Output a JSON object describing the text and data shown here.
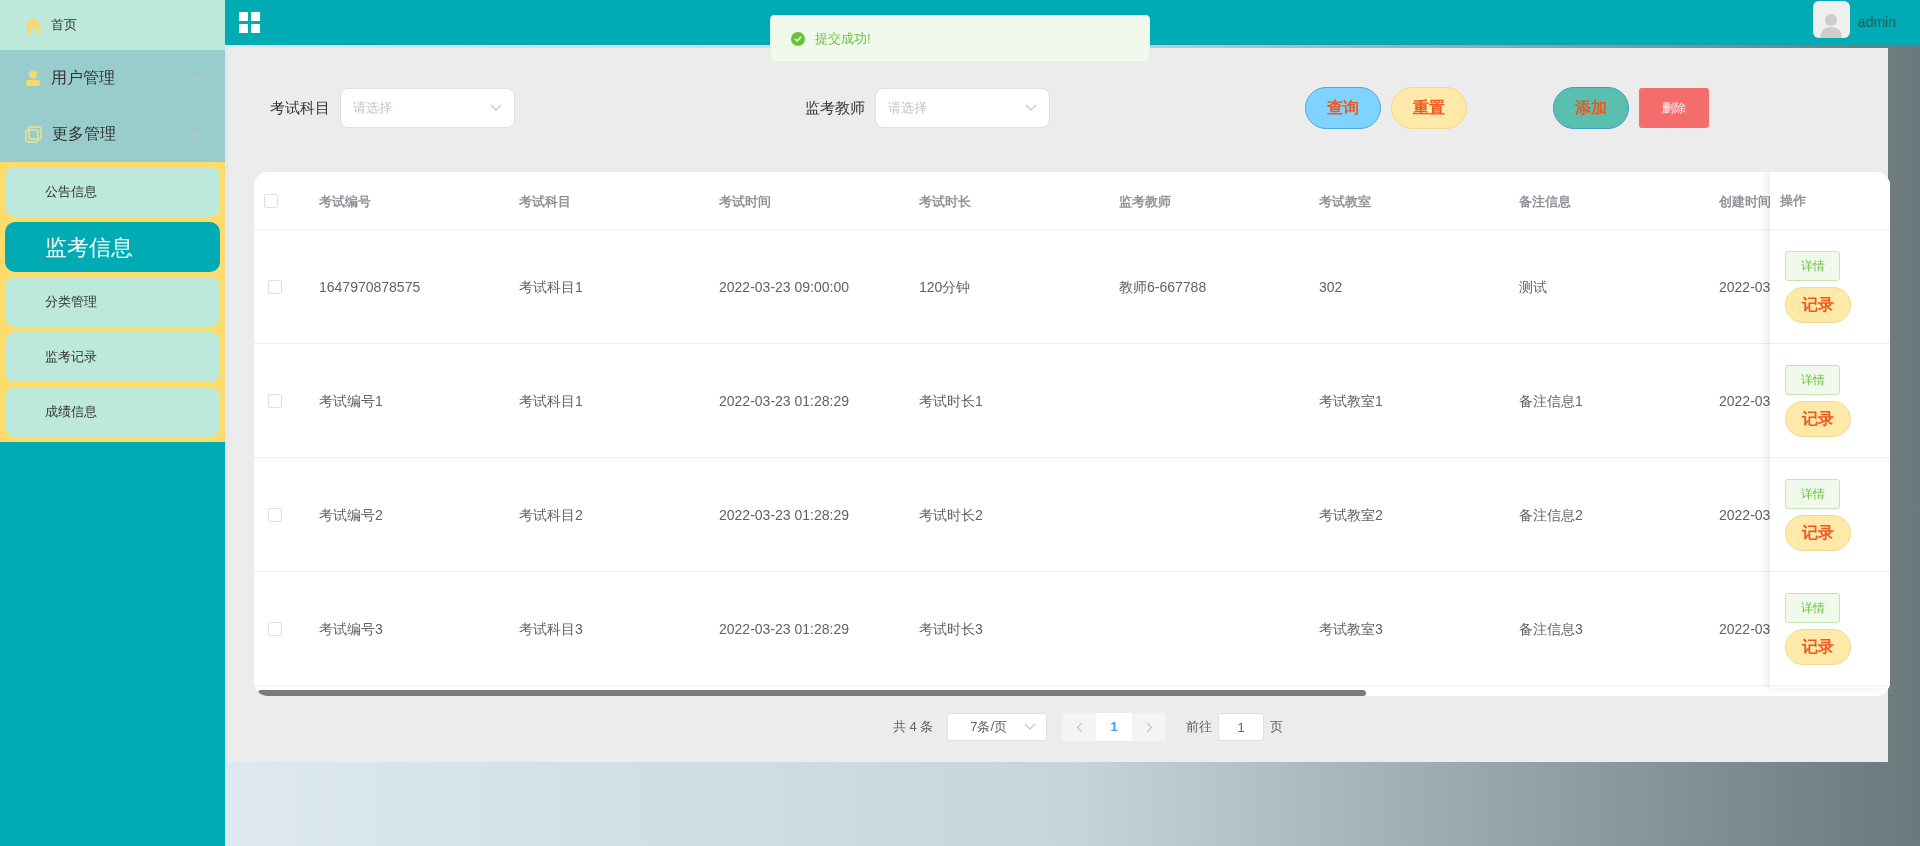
{
  "topbar": {
    "user": "admin"
  },
  "toast": {
    "kind": "success",
    "message": "提交成功!"
  },
  "sidebar": {
    "items": [
      {
        "kind": "link",
        "label": "首页"
      },
      {
        "kind": "group",
        "label": "用户管理",
        "expanded": false
      },
      {
        "kind": "group",
        "label": "更多管理",
        "expanded": true,
        "children": [
          {
            "label": "公告信息",
            "selected": false
          },
          {
            "label": "监考信息",
            "selected": true
          },
          {
            "label": "分类管理",
            "selected": false
          },
          {
            "label": "监考记录",
            "selected": false
          },
          {
            "label": "成绩信息",
            "selected": false
          }
        ]
      }
    ]
  },
  "filters": [
    {
      "label": "考试科目",
      "placeholder": "请选择"
    },
    {
      "label": "监考教师",
      "placeholder": "请选择"
    }
  ],
  "buttons": [
    {
      "kind": "query",
      "label": "查询"
    },
    {
      "kind": "reset",
      "label": "重置"
    },
    {
      "kind": "add",
      "label": "添加"
    },
    {
      "kind": "delete",
      "label": "删除"
    }
  ],
  "table": {
    "select_all_checked": false,
    "columns": [
      "考试编号",
      "考试科目",
      "考试时间",
      "考试时长",
      "监考教师",
      "考试教室",
      "备注信息",
      "创建时间"
    ],
    "actions_column": "操作",
    "rows": [
      {
        "checked": false,
        "cells": [
          "1647970878575",
          "考试科目1",
          "2022-03-23 09:00:00",
          "120分钟",
          "教师6-667788",
          "302",
          "测试",
          "2022-03"
        ],
        "actions": [
          {
            "kind": "detail",
            "label": "详情"
          },
          {
            "kind": "record",
            "label": "记录"
          }
        ]
      },
      {
        "checked": false,
        "cells": [
          "考试编号1",
          "考试科目1",
          "2022-03-23 01:28:29",
          "考试时长1",
          null,
          "考试教室1",
          "备注信息1",
          "2022-03"
        ],
        "actions": [
          {
            "kind": "detail",
            "label": "详情"
          },
          {
            "kind": "record",
            "label": "记录"
          }
        ]
      },
      {
        "checked": false,
        "cells": [
          "考试编号2",
          "考试科目2",
          "2022-03-23 01:28:29",
          "考试时长2",
          null,
          "考试教室2",
          "备注信息2",
          "2022-03"
        ],
        "actions": [
          {
            "kind": "detail",
            "label": "详情"
          },
          {
            "kind": "record",
            "label": "记录"
          }
        ]
      },
      {
        "checked": false,
        "cells": [
          "考试编号3",
          "考试科目3",
          "2022-03-23 01:28:29",
          "考试时长3",
          null,
          "考试教室3",
          "备注信息3",
          "2022-03"
        ],
        "actions": [
          {
            "kind": "detail",
            "label": "详情"
          },
          {
            "kind": "record",
            "label": "记录"
          }
        ]
      }
    ]
  },
  "pagination": {
    "total": "共 4 条",
    "page_size": "7条/页",
    "pages": [
      {
        "label": "1",
        "selected": true
      }
    ],
    "goto_label": "前往",
    "goto_value": "1",
    "goto_suffix": "页"
  }
}
